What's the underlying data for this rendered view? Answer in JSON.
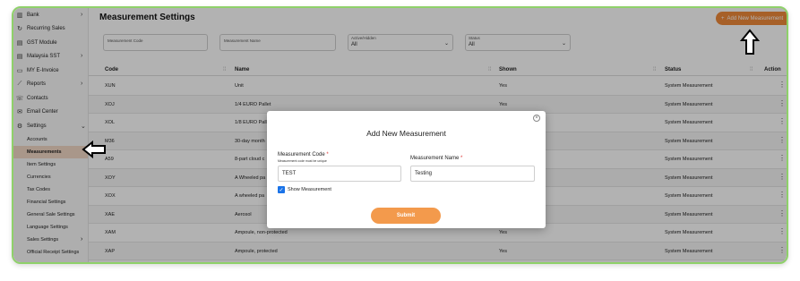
{
  "sidebar": {
    "items": [
      {
        "label": "Bank",
        "icon": "bank-icon",
        "chevron": "›"
      },
      {
        "label": "Recurring Sales",
        "icon": "recurring-icon",
        "chevron": ""
      },
      {
        "label": "GST Module",
        "icon": "document-icon",
        "chevron": ""
      },
      {
        "label": "Malaysia SST",
        "icon": "document-icon",
        "chevron": "›"
      },
      {
        "label": "MY E-Invoice",
        "icon": "monitor-icon",
        "chevron": ""
      },
      {
        "label": "Reports",
        "icon": "chart-icon",
        "chevron": "›"
      },
      {
        "label": "Contacts",
        "icon": "contacts-icon",
        "chevron": ""
      },
      {
        "label": "Email Center",
        "icon": "email-icon",
        "chevron": ""
      },
      {
        "label": "Settings",
        "icon": "gear-icon",
        "chevron": "⌄"
      }
    ],
    "sub_items": [
      {
        "label": "Accounts"
      },
      {
        "label": "Measurements"
      },
      {
        "label": "Item Settings"
      },
      {
        "label": "Currencies"
      },
      {
        "label": "Tax Codes"
      },
      {
        "label": "Financial Settings"
      },
      {
        "label": "General Sale Settings"
      },
      {
        "label": "Language Settings"
      },
      {
        "label": "Sales Settings"
      },
      {
        "label": "Official Receipt Settings"
      }
    ],
    "active_sub": "Measurements"
  },
  "header": {
    "title": "Measurement Settings",
    "add_button": "Add New Measurement",
    "add_icon": "+"
  },
  "filters": {
    "code_placeholder": "Measurement Code",
    "name_placeholder": "Measurement Name",
    "active_label": "Active/Hidden",
    "active_value": "All",
    "status_label": "Status",
    "status_value": "All"
  },
  "table": {
    "columns": [
      "Code",
      "Name",
      "Shown",
      "Status",
      "Action"
    ],
    "rows": [
      {
        "code": "XUN",
        "name": "Unit",
        "shown": "Yes",
        "status": "System Measurement"
      },
      {
        "code": "XOJ",
        "name": "1/4 EURO Pallet",
        "shown": "Yes",
        "status": "System Measurement"
      },
      {
        "code": "XOL",
        "name": "1/8 EURO Pallet",
        "shown": "",
        "status": "System Measurement"
      },
      {
        "code": "M36",
        "name": "30-day month",
        "shown": "",
        "status": "System Measurement"
      },
      {
        "code": "A59",
        "name": "8-part cloud c",
        "shown": "",
        "status": "System Measurement"
      },
      {
        "code": "XOY",
        "name": "A Wheeled pa",
        "shown": "",
        "status": "System Measurement"
      },
      {
        "code": "XOX",
        "name": "A wheeled pa",
        "shown": "",
        "status": "System Measurement"
      },
      {
        "code": "XAE",
        "name": "Aerosol",
        "shown": "",
        "status": "System Measurement"
      },
      {
        "code": "XAM",
        "name": "Ampoule, non-protected",
        "shown": "Yes",
        "status": "System Measurement"
      },
      {
        "code": "XAP",
        "name": "Ampoule, protected",
        "shown": "Yes",
        "status": "System Measurement"
      }
    ]
  },
  "modal": {
    "title": "Add New Measurement",
    "code_label": "Measurement Code",
    "code_required": "*",
    "code_hint": "Measurement code must be unique",
    "code_value": "TEST",
    "name_label": "Measurement Name",
    "name_required": "*",
    "name_value": "Testing",
    "checkbox_label": "Show Measurement",
    "checkbox_checked": true,
    "submit_label": "Submit",
    "close_icon": "×"
  },
  "colors": {
    "accent": "#f08a3a",
    "frame_border": "#8fd16a",
    "active_item": "#f3d8c6",
    "checkbox": "#1a73e8"
  }
}
